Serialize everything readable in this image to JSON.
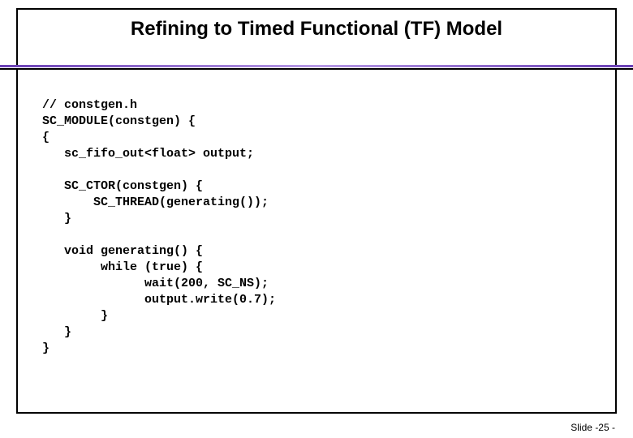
{
  "title": "Refining to Timed Functional (TF) Model",
  "code_lines": [
    "// constgen.h",
    "SC_MODULE(constgen) {",
    "{",
    "   sc_fifo_out<float> output;",
    "",
    "   SC_CTOR(constgen) {",
    "       SC_THREAD(generating());",
    "   }",
    "",
    "   void generating() {",
    "        while (true) {",
    "              wait(200, SC_NS);",
    "              output.write(0.7);",
    "        }",
    "   }",
    "}"
  ],
  "footer": "Slide -25 -"
}
